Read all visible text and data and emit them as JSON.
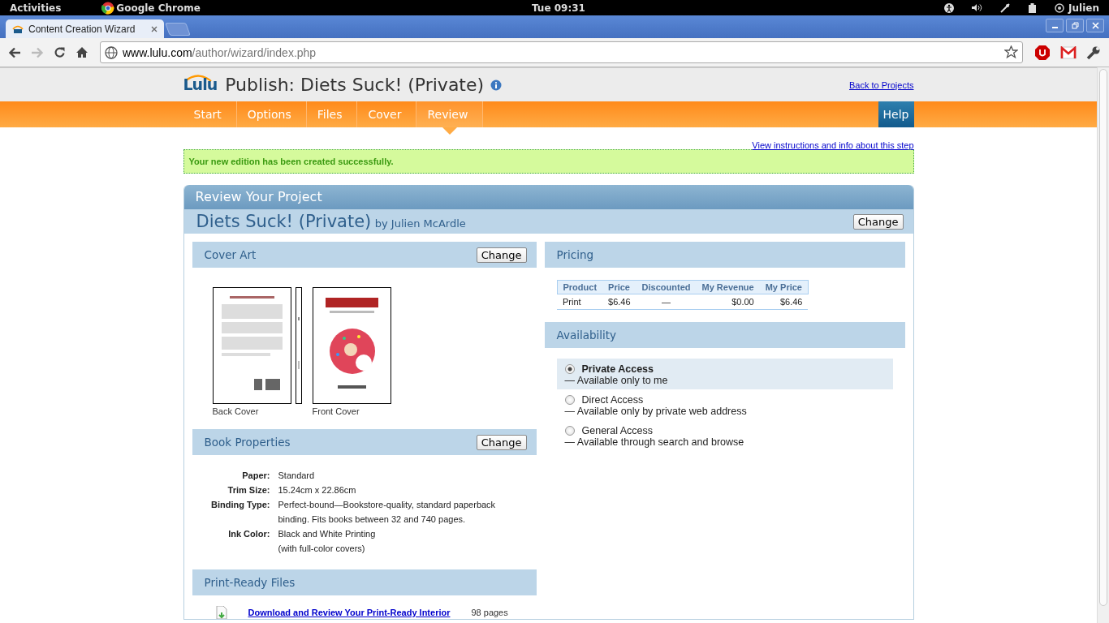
{
  "system_bar": {
    "activities": "Activities",
    "app": "Google Chrome",
    "clock": "Tue 09:31",
    "user": "Julien"
  },
  "browser": {
    "tabs": [
      {
        "title": "Content Creation Wizard",
        "selected": true
      }
    ],
    "url_host": "www.lulu.com",
    "url_path": "/author/wizard/index.php"
  },
  "header": {
    "logo": "Lulu",
    "title": "Publish: Diets Suck! (Private)",
    "back_link": "Back to Projects"
  },
  "nav": {
    "steps": [
      {
        "label": "Start",
        "selected": false
      },
      {
        "label": "Options",
        "selected": false
      },
      {
        "label": "Files",
        "selected": false
      },
      {
        "label": "Cover",
        "selected": false
      },
      {
        "label": "Review",
        "selected": true
      }
    ],
    "help": "Help"
  },
  "instructions_link": "View instructions and info about this step",
  "notice": "Your new edition has been created successfully.",
  "review": {
    "heading": "Review Your Project",
    "project_title": "Diets Suck! (Private)",
    "byline": "by Julien McArdle",
    "change": "Change",
    "cover_art": {
      "title": "Cover Art",
      "change": "Change",
      "captions": [
        "Back Cover",
        "Front Cover"
      ]
    },
    "book_properties": {
      "title": "Book Properties",
      "change": "Change",
      "rows": [
        {
          "label": "Paper:",
          "lines": [
            "Standard"
          ]
        },
        {
          "label": "Trim Size:",
          "lines": [
            "15.24cm x 22.86cm"
          ]
        },
        {
          "label": "Binding Type:",
          "lines": [
            "Perfect-bound—Bookstore-quality, standard paperback binding. Fits books between 32 and 740 pages."
          ]
        },
        {
          "label": "Ink Color:",
          "lines": [
            "Black and White Printing",
            "(with full-color covers)"
          ]
        }
      ]
    },
    "files": {
      "title": "Print-Ready Files",
      "items": [
        {
          "link": "Download and Review Your Print-Ready Interior",
          "pages": "98 pages"
        }
      ]
    },
    "pricing": {
      "title": "Pricing",
      "columns": [
        "Product",
        "Price",
        "Discounted",
        "My Revenue",
        "My Price"
      ],
      "rows": [
        [
          "Print",
          "$6.46",
          "—",
          "$0.00",
          "$6.46"
        ]
      ]
    },
    "availability": {
      "title": "Availability",
      "options": [
        {
          "name": "Private Access",
          "description": "— Available only to me",
          "selected": true
        },
        {
          "name": "Direct Access",
          "description": "— Available only by private web address",
          "selected": false
        },
        {
          "name": "General Access",
          "description": "— Available through search and browse",
          "selected": false
        }
      ]
    }
  }
}
